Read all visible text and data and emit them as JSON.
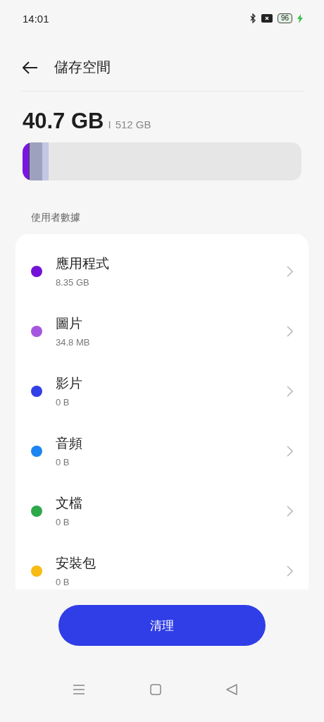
{
  "status_bar": {
    "time": "14:01",
    "battery": "96",
    "charging": true
  },
  "header": {
    "title": "儲存空間"
  },
  "storage": {
    "used": "40.7 GB",
    "separator": "I",
    "total": "512 GB",
    "segments": [
      {
        "color": "#7a16e0",
        "level": 0.022
      },
      {
        "color": "#3c4058",
        "level": 0.004
      },
      {
        "color": "#9ea1bd",
        "level": 0.045
      },
      {
        "color": "#c2c7e3",
        "level": 0.022
      }
    ]
  },
  "section_label": "使用者數據",
  "categories": [
    {
      "name": "應用程式",
      "size": "8.35 GB",
      "color": "#7212d6"
    },
    {
      "name": "圖片",
      "size": "34.8 MB",
      "color": "#a557e0"
    },
    {
      "name": "影片",
      "size": "0 B",
      "color": "#3340e6"
    },
    {
      "name": "音頻",
      "size": "0 B",
      "color": "#1b85f2"
    },
    {
      "name": "文檔",
      "size": "0 B",
      "color": "#2fa84a"
    },
    {
      "name": "安裝包",
      "size": "0 B",
      "color": "#f7bb14"
    }
  ],
  "clean_button": "清理"
}
